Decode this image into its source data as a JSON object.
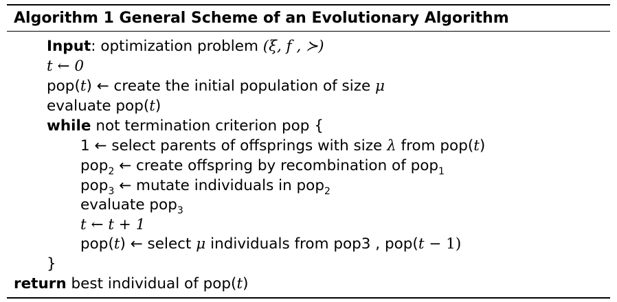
{
  "algorithm": {
    "caption": "Algorithm 1 General Scheme of an Evolutionary Algorithm",
    "lines": [
      {
        "kw": "Input",
        "text": ": optimization problem ",
        "math": "(ξ, f , ≻)"
      },
      {
        "math": "t ← 0"
      },
      {
        "pre": "pop(",
        "math1": "t",
        "post": ") ← create the initial population of size ",
        "math2": "μ"
      },
      {
        "pre": "evaluate pop(",
        "math1": "t",
        "post": ")"
      },
      {
        "kw": "while",
        "text": " not termination criterion pop {"
      },
      {
        "pre": "1 ← select parents of offsprings with size ",
        "math1": "λ",
        "post": " from pop(",
        "math2": "t",
        "post2": ")"
      },
      {
        "pre": "pop",
        "sub1": "2",
        "mid": " ← create offspring by recombination of pop",
        "sub2": "1"
      },
      {
        "pre": "pop",
        "sub1": "3",
        "mid": " ← mutate individuals in pop",
        "sub2": "2"
      },
      {
        "pre": "evaluate pop",
        "sub1": "3"
      },
      {
        "math": "t ← t + 1"
      },
      {
        "pre": "pop(",
        "math1": "t",
        "post": ") ← select ",
        "math2": "μ",
        "post2": " individuals from pop3 , pop(",
        "math3": "t",
        "post3": " − 1)"
      },
      {
        "text": "}"
      },
      {
        "kw": "return",
        "text": " best individual of pop(",
        "math1": "t",
        "post": ")"
      }
    ]
  }
}
